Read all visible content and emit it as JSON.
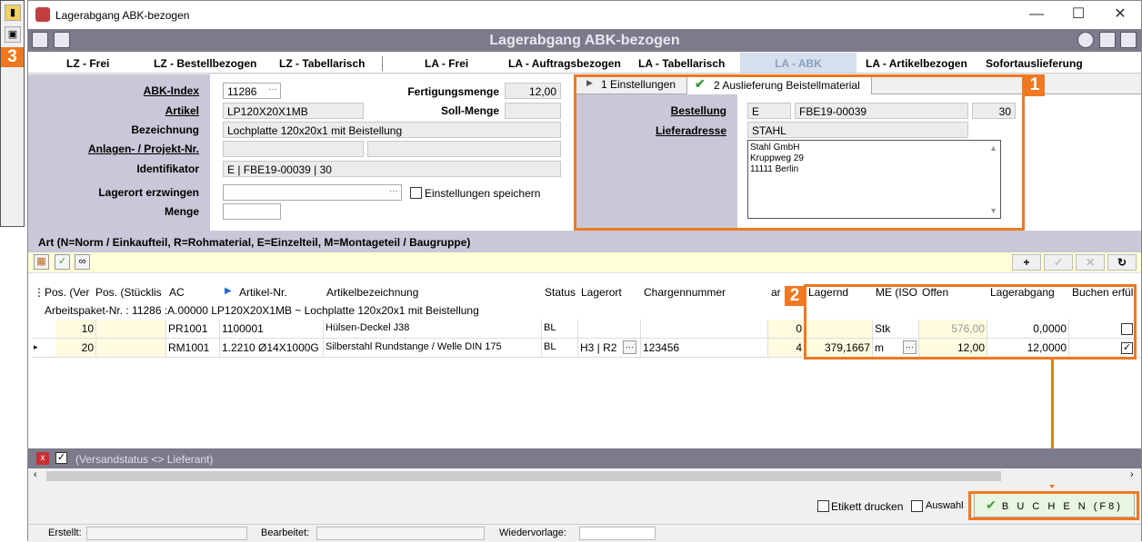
{
  "leftbar": {
    "badge": "3"
  },
  "window": {
    "title": "Lagerabgang ABK-bezogen",
    "minimize": "—",
    "maximize": "☐",
    "close": "✕"
  },
  "header": {
    "title": "Lagerabgang ABK-bezogen"
  },
  "tabs": [
    {
      "label": "LZ - Frei"
    },
    {
      "label": "LZ - Bestellbezogen"
    },
    {
      "label": "LZ - Tabellarisch"
    },
    {
      "label": "LA - Frei"
    },
    {
      "label": "LA - Auftragsbezogen"
    },
    {
      "label": "LA - Tabellarisch"
    },
    {
      "label": "LA - ABK"
    },
    {
      "label": "LA - Artikelbezogen"
    },
    {
      "label": "Sofortauslieferung"
    }
  ],
  "form": {
    "abk_label": "ABK-Index",
    "abk_value": "11286",
    "artikel_label": "Artikel",
    "artikel_value": "LP120X20X1MB",
    "bez_label": "Bezeichnung",
    "bez_value": "Lochplatte 120x20x1 mit Beistellung",
    "anl_label": "Anlagen- / Projekt-Nr.",
    "ident_label": "Identifikator",
    "ident_value": "E | FBE19-00039 | 30",
    "lagerort_label": "Lagerort erzwingen",
    "menge_label": "Menge",
    "fert_label": "Fertigungsmenge",
    "fert_value": "12,00",
    "soll_label": "Soll-Menge",
    "einst_label": "Einstellungen speichern"
  },
  "rpanel": {
    "tab1": "1 Einstellungen",
    "tab2": "2 Auslieferung Beistellmaterial",
    "bestellung_label": "Bestellung",
    "liefer_label": "Lieferadresse",
    "best_typ": "E",
    "best_nr": "FBE19-00039",
    "best_pos": "30",
    "liefer_name": "STAHL",
    "addr1": "Stahl GmbH",
    "addr2": "Kruppweg 29",
    "addr3": "11111 Berlin",
    "badge": "1"
  },
  "art": {
    "title": "Art (N=Norm / Einkaufteil, R=Rohmaterial, E=Einzelteil, M=Montageteil / Baugruppe)"
  },
  "grid": {
    "headers": [
      "Pos. (Ver",
      "Pos. (Stücklis",
      "AC",
      "Artikel-Nr.",
      "Artikelbezeichnung",
      "Status",
      "Lagerort",
      "Chargennummer",
      "ar",
      "Lagernd",
      "ME (ISO",
      "Offen",
      "Lagerabgang",
      "Buchen erfüll"
    ],
    "group": "Arbeitspaket-Nr. :  11286 :A.00000 LP120X20X1MB ~ Lochplatte 120x20x1 mit Beistellung",
    "rows": [
      {
        "pos": "10",
        "ac": "PR1001",
        "art": "1100001",
        "bez": "Hülsen-Deckel J38",
        "status": "BL",
        "lagerort": "",
        "charge": "",
        "ar": "0",
        "lagernd": "",
        "me": "Stk",
        "offen": "576,00",
        "abgang": "0,0000",
        "buchen": ""
      },
      {
        "pos": "20",
        "ac": "RM1001",
        "art": "1.2210 Ø14X1000G",
        "bez": "Silberstahl Rundstange / Welle DIN 175",
        "status": "BL",
        "lagerort": "H3 | R2",
        "charge": "123456",
        "ar": "4",
        "lagernd": "379,1667",
        "me": "m",
        "offen": "12,00",
        "abgang": "12,0000",
        "buchen": "✓"
      }
    ],
    "badge": "2"
  },
  "filter": {
    "text": "(Versandstatus <> Lieferant)"
  },
  "bottom": {
    "etikett": "Etikett drucken",
    "auswahl": "Auswahl",
    "buchen": "B U C H E N  (F8)"
  },
  "footer": {
    "erstellt": "Erstellt:",
    "bearbeitet": "Bearbeitet:",
    "wiedervorlage": "Wiedervorlage:"
  }
}
